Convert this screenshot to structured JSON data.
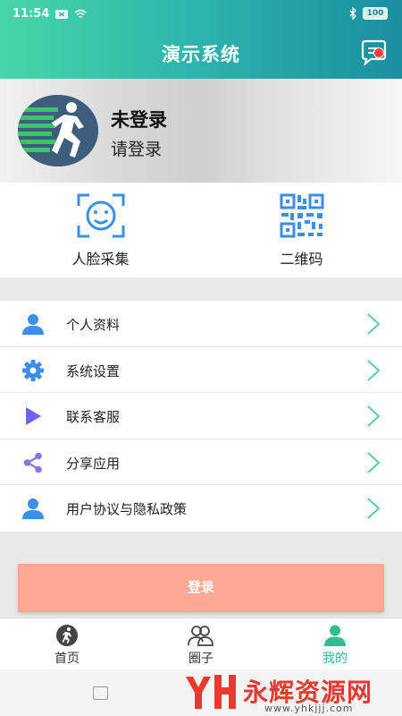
{
  "status_bar": {
    "time": "11:54",
    "battery": "100"
  },
  "header": {
    "title": "演示系统"
  },
  "profile": {
    "name": "未登录",
    "subtitle": "请登录"
  },
  "quick_actions": [
    {
      "label": "人脸采集",
      "icon": "face-scan-icon"
    },
    {
      "label": "二维码",
      "icon": "qr-code-icon"
    }
  ],
  "menu": [
    {
      "label": "个人资料",
      "icon": "person-icon"
    },
    {
      "label": "系统设置",
      "icon": "gear-icon"
    },
    {
      "label": "联系客服",
      "icon": "play-icon"
    },
    {
      "label": "分享应用",
      "icon": "share-icon"
    },
    {
      "label": "用户协议与隐私政策",
      "icon": "person-icon"
    }
  ],
  "login_button": "登录",
  "tabs": [
    {
      "label": "首页",
      "icon": "runner-icon",
      "active": false
    },
    {
      "label": "圈子",
      "icon": "group-icon",
      "active": false
    },
    {
      "label": "我的",
      "icon": "person-icon",
      "active": true
    }
  ],
  "watermark": {
    "text": "永辉资源网",
    "url": "www.yhkjjj.com"
  },
  "colors": {
    "accent": "#2fbf8f",
    "header_start": "#47d6a6",
    "header_end": "#1b8ea0",
    "login": "#ffa894",
    "badge": "#ff3b3b"
  }
}
